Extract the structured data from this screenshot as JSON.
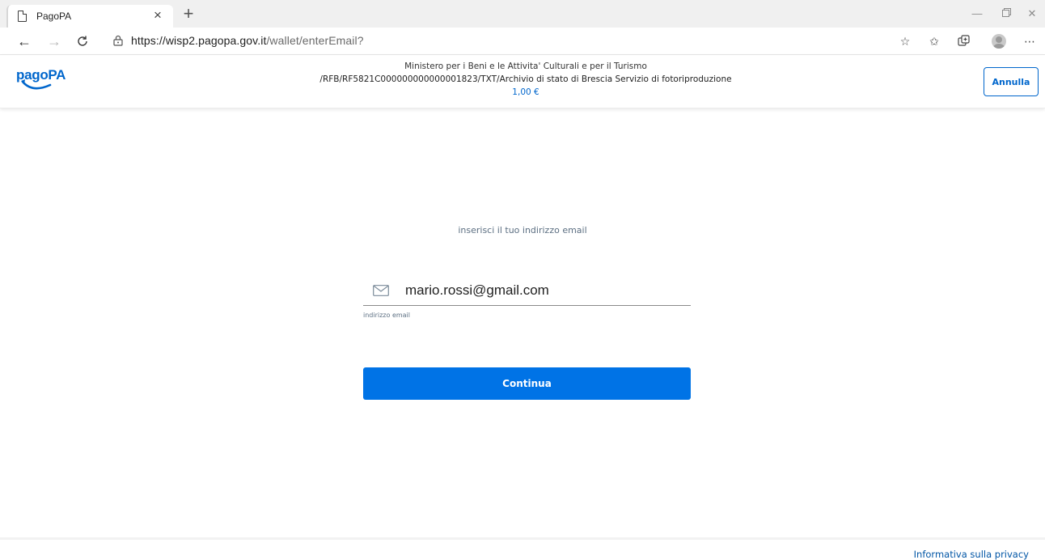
{
  "browser": {
    "tab_title": "PagoPA",
    "tab_close": "×",
    "new_tab": "+",
    "url_host": "https://wisp2.pagopa.gov.it",
    "url_path": "/wallet/enterEmail?",
    "icons": [
      "page-icon",
      "back-icon",
      "forward-icon",
      "refresh-icon",
      "lock-icon",
      "add-favorite-icon",
      "favorites-icon",
      "collections-icon",
      "profile-avatar",
      "more-icon",
      "minimize-icon",
      "maximize-icon",
      "close-window-icon"
    ]
  },
  "header": {
    "logo_text": "pagoPA",
    "organization": "Ministero per i Beni e le Attivita' Culturali e per il Turismo",
    "description": "/RFB/RF5821C000000000000001823/TXT/Archivio di stato di Brescia Servizio di fotoriproduzione",
    "amount": "1,00 €",
    "cancel_label": "Annulla"
  },
  "main": {
    "prompt": "inserisci il tuo indirizzo email",
    "email_value": "mario.rossi@gmail.com",
    "email_hint": "indirizzo email",
    "continue_label": "Continua"
  },
  "footer": {
    "privacy_label": "Informativa sulla privacy"
  },
  "colors": {
    "brand_blue": "#0066cc",
    "button_blue": "#0073e6",
    "muted_text": "#5c6f82"
  }
}
